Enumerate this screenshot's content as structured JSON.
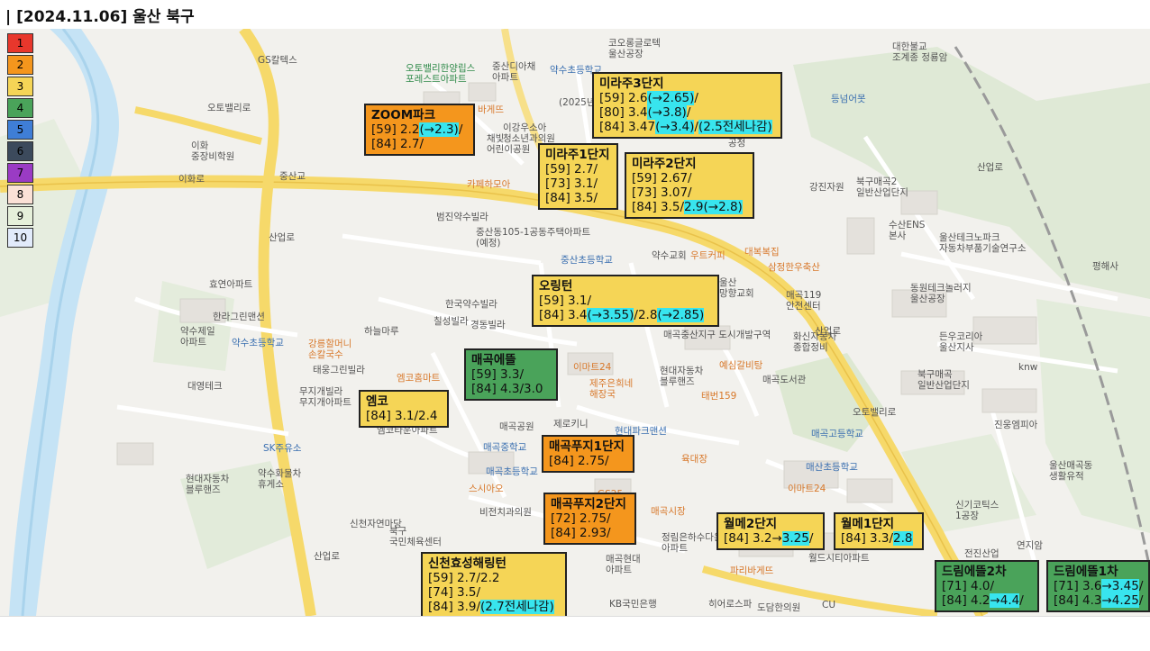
{
  "title": "| [2024.11.06] 울산 북구",
  "legend": [
    {
      "label": "1",
      "color": "#e8372c"
    },
    {
      "label": "2",
      "color": "#f4961d"
    },
    {
      "label": "3",
      "color": "#f5d556"
    },
    {
      "label": "4",
      "color": "#4aa35a"
    },
    {
      "label": "5",
      "color": "#3f7ed6"
    },
    {
      "label": "6",
      "color": "#3c4a5c"
    },
    {
      "label": "7",
      "color": "#9a3bc4"
    },
    {
      "label": "8",
      "color": "#fbe1d6"
    },
    {
      "label": "9",
      "color": "#e6f0da"
    },
    {
      "label": "10",
      "color": "#e2ebfb"
    }
  ],
  "complexes": [
    {
      "id": "zoom",
      "color": "#f4961d",
      "name": "ZOOM파크",
      "lines": [
        [
          "[59] 2.2",
          {
            "hl": "(→2.3)"
          },
          "/"
        ],
        [
          "[84] 2.7/"
        ]
      ]
    },
    {
      "id": "mirae3",
      "color": "#f5d556",
      "name": "미라주3단지",
      "lines": [
        [
          "[59] 2.6",
          {
            "hl": "(→2.65)"
          },
          "/"
        ],
        [
          "[80] 3.4",
          {
            "hl": "(→3.8)"
          },
          "/"
        ],
        [
          "[84] 3.47",
          {
            "hl": "(→3.4)"
          },
          "/",
          {
            "hl": "(2.5전세나감)"
          }
        ]
      ]
    },
    {
      "id": "mirae1",
      "color": "#f5d556",
      "name": "미라주1단지",
      "lines": [
        [
          "[59] 2.7/"
        ],
        [
          "[73] 3.1/"
        ],
        [
          "[84] 3.5/"
        ]
      ]
    },
    {
      "id": "mirae2",
      "color": "#f5d556",
      "name": "미라주2단지",
      "lines": [
        [
          "[59] 2.67/"
        ],
        [
          "[73] 3.07/"
        ],
        [
          "[84] 3.5/",
          {
            "hl": "2.9(→2.8)"
          }
        ]
      ]
    },
    {
      "id": "orington",
      "color": "#f5d556",
      "name": "오링턴",
      "lines": [
        [
          "[59] 3.1/"
        ],
        [
          "[84] 3.4",
          {
            "hl": "(→3.55)"
          },
          "/2.8",
          {
            "hl": "(→2.85)"
          }
        ]
      ]
    },
    {
      "id": "maegok_edeul",
      "color": "#4aa35a",
      "name": "매곡에뜰",
      "lines": [
        [
          "[59] 3.3/"
        ],
        [
          "[84] 4.3/3.0"
        ]
      ]
    },
    {
      "id": "emko",
      "color": "#f5d556",
      "name": "엠코",
      "lines": [
        [
          "[84] 3.1/2.4"
        ]
      ]
    },
    {
      "id": "puji1",
      "color": "#f4961d",
      "name": "매곡푸지1단지",
      "lines": [
        [
          "[84] 2.75/"
        ]
      ]
    },
    {
      "id": "puji2",
      "color": "#f4961d",
      "name": "매곡푸지2단지",
      "lines": [
        [
          "[72] 2.75/"
        ],
        [
          "[84] 2.93/"
        ]
      ]
    },
    {
      "id": "hyosung",
      "color": "#f5d556",
      "name": "신천효성해링턴",
      "lines": [
        [
          "[59] 2.7/2.2"
        ],
        [
          "[74] 3.5/"
        ],
        [
          "[84] 3.9/",
          {
            "hl": "(2.7전세나감)"
          }
        ]
      ]
    },
    {
      "id": "wolme2",
      "color": "#f5d556",
      "name": "월메2단지",
      "lines": [
        [
          "[84] 3.2→",
          {
            "hl": "3.25"
          },
          "/"
        ]
      ]
    },
    {
      "id": "wolme1",
      "color": "#f5d556",
      "name": "월메1단지",
      "lines": [
        [
          "[84] 3.3/",
          {
            "hl": "2.8"
          }
        ]
      ]
    },
    {
      "id": "dream2",
      "color": "#4aa35a",
      "name": "드림에뜰2차",
      "lines": [
        [
          "[71] 4.0/"
        ],
        [
          "[84] 4.2",
          {
            "hl": "→4.4"
          },
          "/"
        ]
      ]
    },
    {
      "id": "dream1",
      "color": "#4aa35a",
      "name": "드림에뜰1차",
      "lines": [
        [
          "[71] 3.6",
          {
            "hl": "→3.45"
          },
          "/"
        ],
        [
          "[84] 4.3",
          {
            "hl": "→4.25"
          },
          "/"
        ]
      ]
    }
  ],
  "pois": [
    {
      "id": "p1",
      "text": "코오롱글로텍\n울산공장"
    },
    {
      "id": "p2",
      "text": "오토밸리한양립스\n포레스트아파트"
    },
    {
      "id": "p3",
      "text": "중산디아채\n아파트"
    },
    {
      "id": "p4",
      "text": "약수초등학교"
    },
    {
      "id": "p5",
      "text": "대한불교\n조계종 정룡암"
    },
    {
      "id": "p6",
      "text": "등넘어못"
    },
    {
      "id": "p7",
      "text": "이화\n중장비학원"
    },
    {
      "id": "p8",
      "text": "중산교"
    },
    {
      "id": "p9",
      "text": "이화로"
    },
    {
      "id": "p10",
      "text": "GS칼텍스"
    },
    {
      "id": "p11",
      "text": "오토밸리로"
    },
    {
      "id": "p12",
      "text": "이강우소아\n청소년과의원"
    },
    {
      "id": "p13",
      "text": "채빛\n어린이공원"
    },
    {
      "id": "p14",
      "text": "카페하모아"
    },
    {
      "id": "p15",
      "text": "범진약수빌라"
    },
    {
      "id": "p16",
      "text": "중산동105-1공동주택아파트\n(예정)"
    },
    {
      "id": "p17",
      "text": "중산초등학교"
    },
    {
      "id": "p18",
      "text": "약수교회"
    },
    {
      "id": "p19",
      "text": "우트커피"
    },
    {
      "id": "p20",
      "text": "대복복집"
    },
    {
      "id": "p21",
      "text": "삼정한우축산"
    },
    {
      "id": "p22",
      "text": "울산\n망향교회"
    },
    {
      "id": "p23",
      "text": "매곡119\n안전센터"
    },
    {
      "id": "p24",
      "text": "강진자원"
    },
    {
      "id": "p25",
      "text": "북구매곡2\n일반산업단지"
    },
    {
      "id": "p26",
      "text": "수산ENS\n본사"
    },
    {
      "id": "p27",
      "text": "울산테크노파크\n자동차부품기술연구소"
    },
    {
      "id": "p28",
      "text": "평해사"
    },
    {
      "id": "p29",
      "text": "동원테크놀러지\n울산공장"
    },
    {
      "id": "p30",
      "text": "효연아파트"
    },
    {
      "id": "p31",
      "text": "한라그린맨션"
    },
    {
      "id": "p32",
      "text": "약수제일\n아파트"
    },
    {
      "id": "p33",
      "text": "약수초등학교"
    },
    {
      "id": "p34",
      "text": "한국약수빌라"
    },
    {
      "id": "p35",
      "text": "칠성빌라"
    },
    {
      "id": "p36",
      "text": "경동빌라"
    },
    {
      "id": "p37",
      "text": "하늘마루"
    },
    {
      "id": "p38",
      "text": "강릉할머니\n손칼국수"
    },
    {
      "id": "p39",
      "text": "태웅그린빌라"
    },
    {
      "id": "p40",
      "text": "엠코홈마트"
    },
    {
      "id": "p41",
      "text": "대영테크"
    },
    {
      "id": "p42",
      "text": "무지개빌라\n무지개아파트"
    },
    {
      "id": "p43",
      "text": "엠코타운아파트"
    },
    {
      "id": "p44",
      "text": "이마트24"
    },
    {
      "id": "p45",
      "text": "제주은희네\n해장국"
    },
    {
      "id": "p46",
      "text": "현대자동차\n블루핸즈"
    },
    {
      "id": "p47",
      "text": "예심갈비탕"
    },
    {
      "id": "p48",
      "text": "매곡도서관"
    },
    {
      "id": "p49",
      "text": "태번159"
    },
    {
      "id": "p50",
      "text": "화신자동차\n종합정비"
    },
    {
      "id": "p51",
      "text": "매곡중산지구 도시개발구역"
    },
    {
      "id": "p52",
      "text": "든우코리아\n울산지사"
    },
    {
      "id": "p53",
      "text": "북구매곡\n일반산업단지"
    },
    {
      "id": "p54",
      "text": "knw"
    },
    {
      "id": "p55",
      "text": "매곡공원"
    },
    {
      "id": "p56",
      "text": "제로키니"
    },
    {
      "id": "p57",
      "text": "현대파크맨션"
    },
    {
      "id": "p58",
      "text": "매곡중학교"
    },
    {
      "id": "p59",
      "text": "매곡초등학교"
    },
    {
      "id": "p60",
      "text": "육대장"
    },
    {
      "id": "p61",
      "text": "매곡고등학교"
    },
    {
      "id": "p62",
      "text": "매산초등학교"
    },
    {
      "id": "p63",
      "text": "진웅엠피아"
    },
    {
      "id": "p64",
      "text": "SK주유소"
    },
    {
      "id": "p65",
      "text": "약수화물차\n휴게소"
    },
    {
      "id": "p66",
      "text": "현대자동차\n블루핸즈"
    },
    {
      "id": "p67",
      "text": "스시아오"
    },
    {
      "id": "p68",
      "text": "GS25"
    },
    {
      "id": "p69",
      "text": "비전치과의원"
    },
    {
      "id": "p70",
      "text": "매곡시장"
    },
    {
      "id": "p71",
      "text": "이마트24"
    },
    {
      "id": "p72",
      "text": "신천자연마당"
    },
    {
      "id": "p73",
      "text": "북구\n국민체육센터"
    },
    {
      "id": "p74",
      "text": "정림은하수다운\n아파트"
    },
    {
      "id": "p75",
      "text": "매곡현대\n아파트"
    },
    {
      "id": "p76",
      "text": "파리바게뜨"
    },
    {
      "id": "p77",
      "text": "월드시티아파트"
    },
    {
      "id": "p78",
      "text": "신기코틱스\n1공장"
    },
    {
      "id": "p79",
      "text": "전진산업"
    },
    {
      "id": "p80",
      "text": "연지암"
    },
    {
      "id": "p81",
      "text": "울산매곡동\n생활유적"
    },
    {
      "id": "p82",
      "text": "KB국민은행"
    },
    {
      "id": "p83",
      "text": "히어로스파"
    },
    {
      "id": "p84",
      "text": "도담한의원"
    },
    {
      "id": "p85",
      "text": "CU"
    },
    {
      "id": "p86",
      "text": "산업로"
    },
    {
      "id": "p87",
      "text": "오토밸리로"
    },
    {
      "id": "p88",
      "text": "산업로"
    },
    {
      "id": "p89",
      "text": "산업로"
    },
    {
      "id": "p90",
      "text": "(2025년"
    },
    {
      "id": "p91",
      "text": "바게뜨"
    },
    {
      "id": "p92",
      "text": "산업로"
    },
    {
      "id": "p93",
      "text": "공정"
    }
  ]
}
